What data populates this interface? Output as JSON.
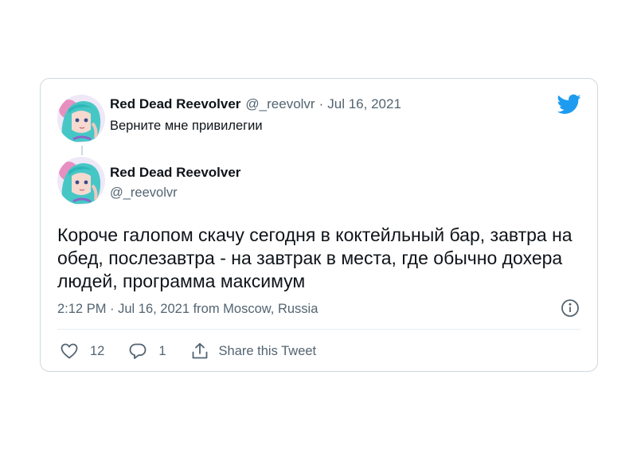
{
  "quoted_tweet": {
    "author_name": "Red Dead Reevolver",
    "author_handle": "@_reevolvr",
    "separator": "·",
    "date": "Jul 16, 2021",
    "text": "Верните мне привилегии"
  },
  "main_tweet": {
    "author_name": "Red Dead Reevolver",
    "author_handle": "@_reevolvr",
    "text": "Короче галопом скачу сегодня в коктейльный бар, завтра на обед, послезавтра - на завтрак в места, где обычно дохера людей, программа максимум",
    "meta": "2:12 PM · Jul 16, 2021 from Moscow, Russia"
  },
  "actions": {
    "like_count": "12",
    "reply_count": "1",
    "share_label": "Share this Tweet"
  },
  "icons": {
    "brand": "twitter-bird-icon",
    "info": "info-icon",
    "like": "heart-icon",
    "reply": "speech-bubble-icon",
    "share": "share-icon"
  },
  "colors": {
    "twitter_blue": "#1d9bf0",
    "text_primary": "#0f1419",
    "text_secondary": "#536471",
    "border": "#cfd9de"
  }
}
